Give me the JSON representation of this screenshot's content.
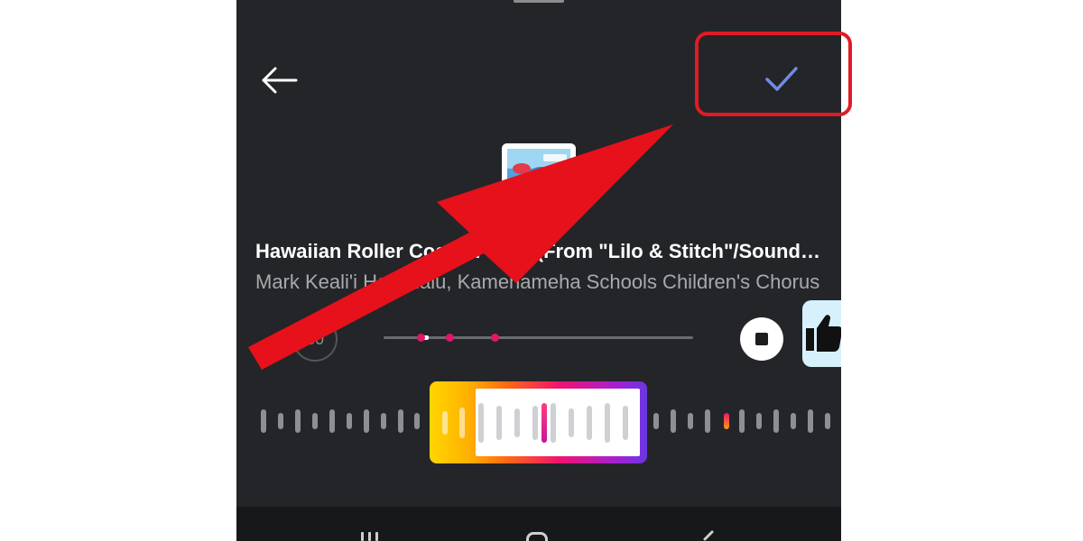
{
  "screen": {
    "back_icon": "arrow-left-icon",
    "done_icon": "checkmark-icon",
    "accent_color": "#6f8ce6"
  },
  "track": {
    "title": "Hawaiian Roller Coaster Ride (From  \"Lilo & Stitch\"/Soundtrack)",
    "artist": "Mark Keali'i Ho'omalu, Kamehameha Schools Children's Chorus"
  },
  "player": {
    "duration_label": "30",
    "stop_icon": "stop-icon",
    "reaction_icon": "thumbs-up-icon"
  },
  "clip_selector": {
    "gradient_colors": [
      "#ffd600",
      "#ff6a13",
      "#f0126f",
      "#a81fd0",
      "#6a36e3"
    ],
    "playhead_color": "#e4156b"
  },
  "system_nav": {
    "recents_icon": "recents-icon",
    "home_icon": "home-icon",
    "back_icon": "nav-back-icon"
  },
  "annotation": {
    "color": "#e01b25",
    "arrow_icon": "red-arrow-icon",
    "highlight": "highlight-box"
  }
}
